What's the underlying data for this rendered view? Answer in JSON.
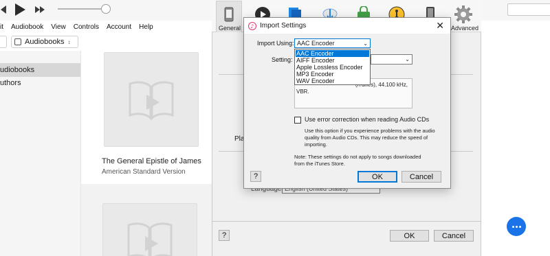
{
  "menu": [
    "it",
    "Audiobook",
    "View",
    "Controls",
    "Account",
    "Help"
  ],
  "library_selector": "Audiobooks",
  "sidebar": {
    "items": [
      {
        "label": "udiobooks",
        "selected": true
      },
      {
        "label": "uthors",
        "selected": false
      }
    ]
  },
  "books": [
    {
      "title": "The General Epistle of James",
      "subtitle": "American Standard Version"
    }
  ],
  "prefs": {
    "tabs": [
      {
        "label": "General",
        "icon": "phone-icon"
      },
      {
        "label": "",
        "icon": "play-icon"
      },
      {
        "label": "",
        "icon": "books-icon"
      },
      {
        "label": "",
        "icon": "download-icon"
      },
      {
        "label": "",
        "icon": "lock-icon"
      },
      {
        "label": "",
        "icon": "parental-icon"
      },
      {
        "label": "",
        "icon": "device-icon"
      },
      {
        "label": "Advanced",
        "icon": "gear-icon"
      }
    ],
    "partial_play_label": "Play",
    "language_label": "Language:",
    "language_value": "English (United States)",
    "help_label": "?",
    "ok_label": "OK",
    "cancel_label": "Cancel"
  },
  "dialog": {
    "title": "Import Settings",
    "import_using_label": "Import Using:",
    "import_using_value": "AAC Encoder",
    "setting_label": "Setting:",
    "encoder_options": [
      "AAC Encoder",
      "AIFF Encoder",
      "Apple Lossless Encoder",
      "MP3 Encoder",
      "WAV Encoder"
    ],
    "selected_option_index": 0,
    "details_line1": "(iTunes), 44.100 kHz,",
    "details_line2": "VBR.",
    "error_correction_label": "Use error correction when reading Audio CDs",
    "error_correction_checked": false,
    "error_correction_note": "Use this option if you experience problems with the audio quality from Audio CDs.  This may reduce the speed of importing.",
    "settings_note": "Note: These settings do not apply to songs downloaded from the iTunes Store.",
    "help_label": "?",
    "ok_label": "OK",
    "cancel_label": "Cancel"
  },
  "colors": {
    "accent": "#0078d7",
    "fab": "#1a73e8",
    "selected_sidebar": "#d7d7d7"
  }
}
